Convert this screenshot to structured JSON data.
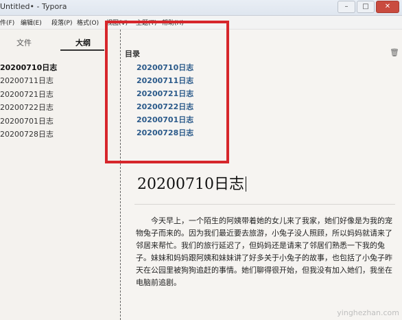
{
  "window": {
    "title": "Untitled• - Typora",
    "controls": {
      "minimize": "–",
      "maximize": "□",
      "close": "✕"
    }
  },
  "menu": [
    "件(F)",
    "编辑(E)",
    "段落(P)",
    "格式(O)",
    "视图(V)",
    "主题(T)",
    "帮助(H)"
  ],
  "sidebar": {
    "tabs": {
      "files": "文件",
      "outline": "大纲"
    },
    "items": [
      "20200710日志",
      "20200711日志",
      "20200721日志",
      "20200722日志",
      "20200701日志",
      "20200728日志"
    ]
  },
  "toc": {
    "heading": "目录",
    "items": [
      "20200710日志",
      "20200711日志",
      "20200721日志",
      "20200722日志",
      "20200701日志",
      "20200728日志"
    ]
  },
  "document": {
    "title": "20200710日志",
    "paragraph": "今天早上，一个陌生的阿姨带着她的女儿来了我家，她们好像是为我的宠物兔子而来的。因为我们最近要去旅游，小兔子没人照顾，所以妈妈就请来了邻居来帮忙。我们的旅行延迟了，但妈妈还是请来了邻居们熟悉一下我的兔子。妹妹和妈妈跟阿姨和妹妹讲了好多关于小兔子的故事，也包括了小兔子昨天在公园里被狗狗追赶的事情。她们聊得很开始，但我没有加入她们，我坐在电脑前追剧。"
  },
  "watermark": "yinghezhan.com",
  "colors": {
    "highlight_box": "#d6262b",
    "toc_link": "#2b5a8a"
  }
}
